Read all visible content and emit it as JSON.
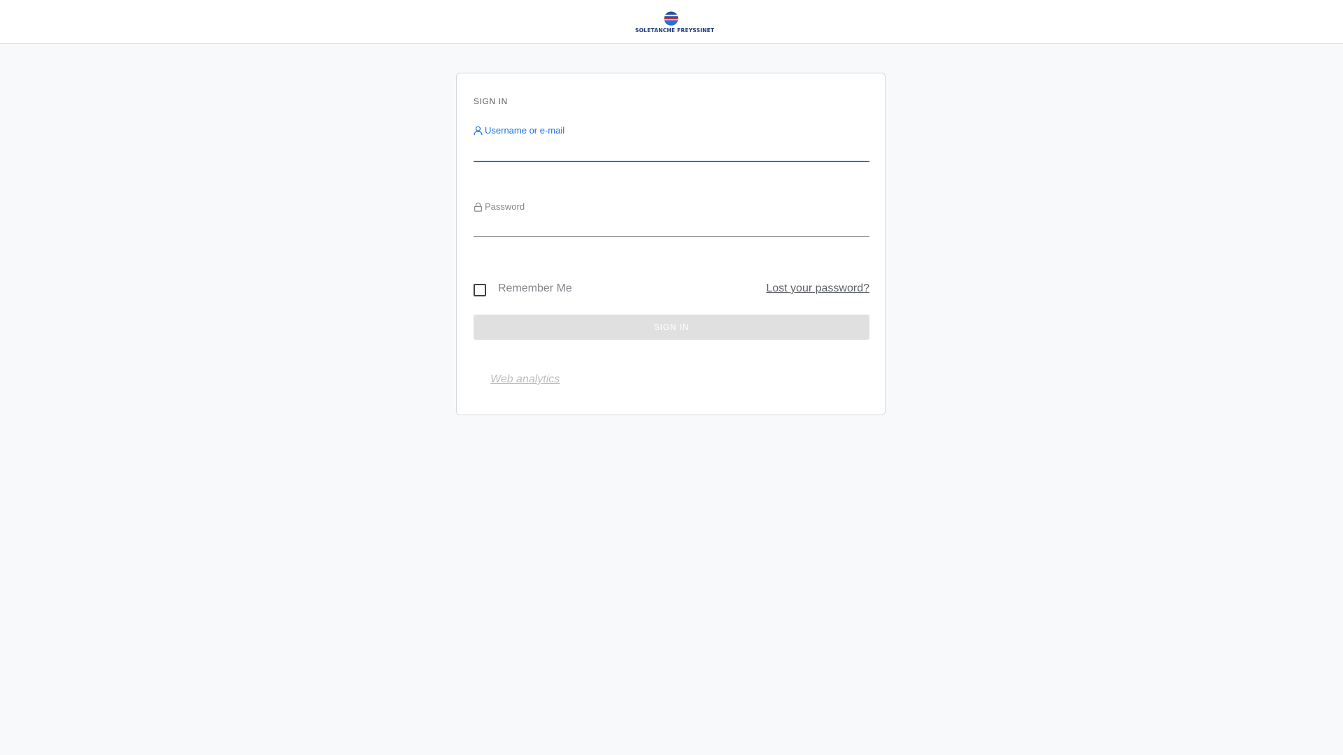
{
  "header": {
    "logo_text": "SOLETANCHE FREYSSINET",
    "logo_icon": "globe-logo-icon"
  },
  "login": {
    "title": "SIGN IN",
    "username_label": "Username or e-mail",
    "username_value": "",
    "password_label": "Password",
    "password_value": "",
    "remember_label": "Remember Me",
    "remember_checked": false,
    "lost_password_label": "Lost your password?",
    "signin_button_label": "SIGN IN",
    "web_analytics_label": "Web analytics"
  },
  "icons": {
    "username": "user-icon",
    "password": "lock-icon"
  },
  "colors": {
    "accent": "#1a73e8",
    "background": "#f8f9fa",
    "button_disabled": "#e0e0e0",
    "logo_blue": "#1f3d7a",
    "logo_red": "#e2231a"
  }
}
